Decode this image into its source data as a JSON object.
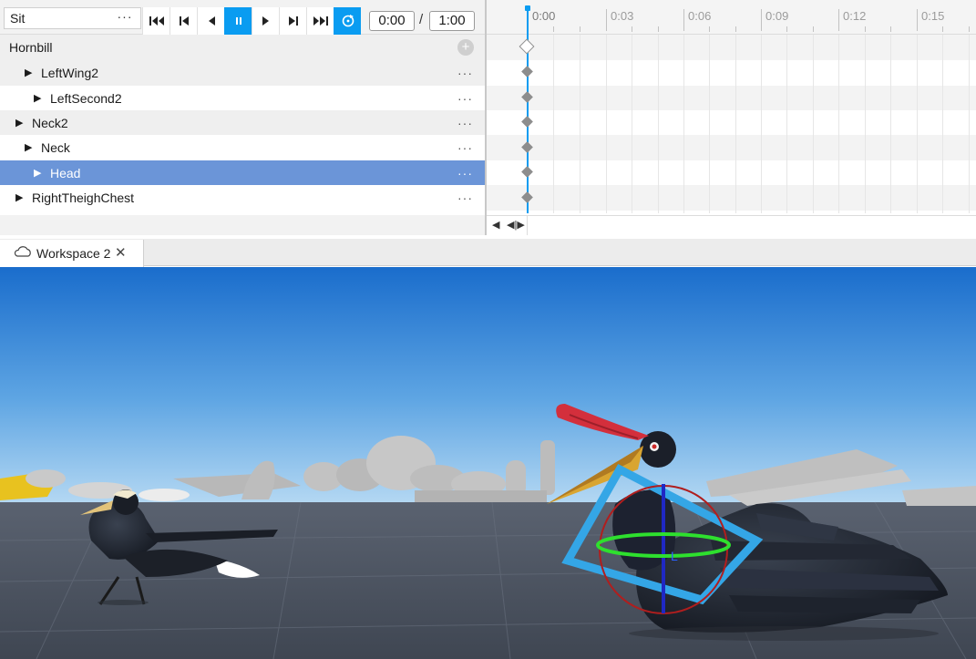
{
  "toolbar": {
    "animation_name": "Sit",
    "more": "···",
    "current_time": "0:00",
    "separator": "/",
    "total_time": "1:00",
    "buttons": [
      "skip-to-start",
      "previous-keyframe",
      "play-reverse",
      "pause",
      "play",
      "next-keyframe",
      "skip-to-end",
      "loop"
    ]
  },
  "tree": {
    "root": "Hornbill",
    "add": "+",
    "items": [
      {
        "label": "LeftWing2"
      },
      {
        "label": "LeftSecond2"
      },
      {
        "label": "Neck2"
      },
      {
        "label": "Neck"
      },
      {
        "label": "Head"
      },
      {
        "label": "RightTheighChest"
      }
    ],
    "more": "···"
  },
  "timeline": {
    "ruler_labels": [
      "0:00",
      "0:03",
      "0:06",
      "0:09",
      "0:12",
      "0:15"
    ],
    "footer_left": "◀",
    "footer_zoom": "◀|▶"
  },
  "tabs": [
    {
      "label": "Workspace 2",
      "close": "✕"
    }
  ],
  "colors": {
    "accent": "#0a9cf1",
    "selection": "#6b95d8",
    "sky_top": "#1a6dcc",
    "sky_bottom": "#a9d2f1",
    "ground": "#4a5260"
  }
}
